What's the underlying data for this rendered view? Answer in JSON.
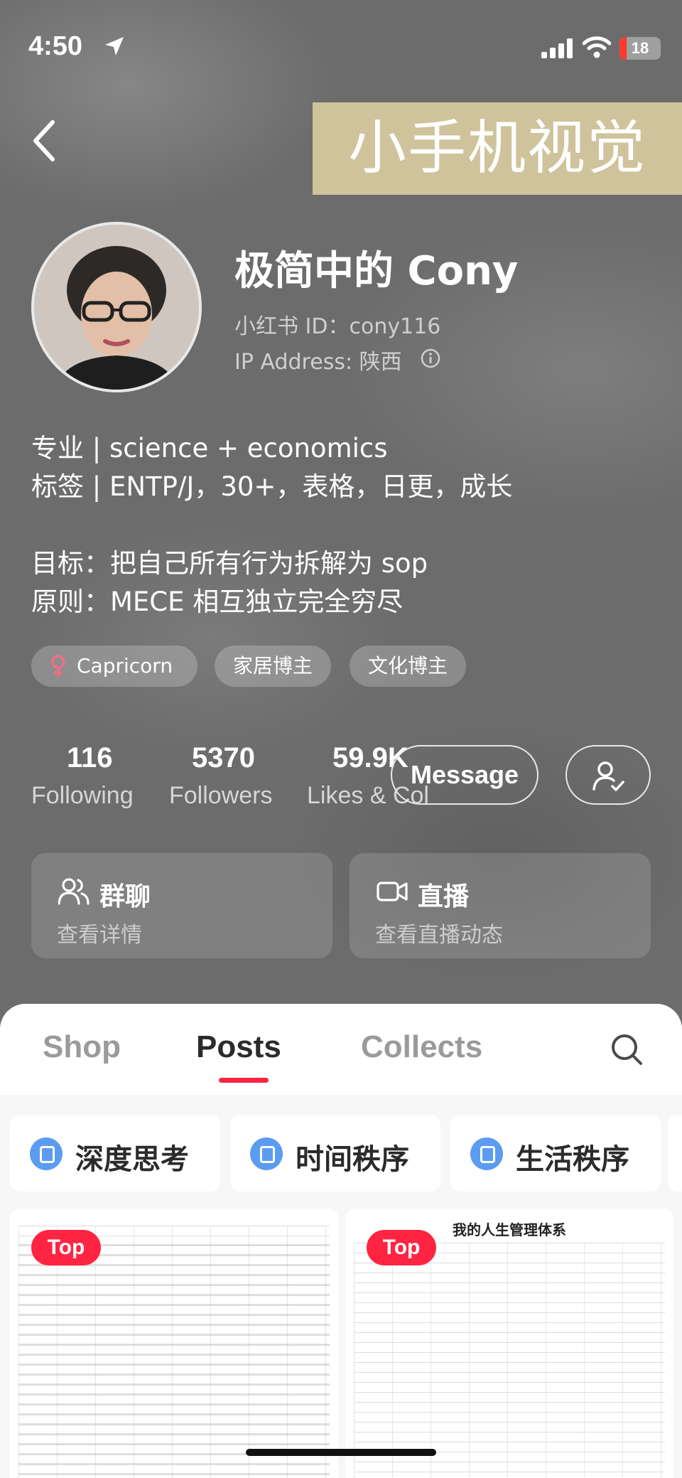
{
  "status": {
    "time": "4:50",
    "battery": "18",
    "battery_color": "#ff3b30"
  },
  "watermark": "小手机视觉",
  "profile": {
    "nickname": "极简中的 Cony",
    "red_id": "小红书 ID：cony116",
    "ip": "IP Address: 陕西",
    "bio": [
      "专业 | science + economics",
      "标签 | ENTP/J，30+，表格，日更，成长",
      "",
      "目标：把自己所有行为拆解为 sop",
      "原则：MECE 相互独立完全穷尽"
    ],
    "tags": [
      "Capricorn",
      "家居博主",
      "文化博主"
    ]
  },
  "stats": {
    "following_count": "116",
    "following_label": "Following",
    "followers_count": "5370",
    "followers_label": "Followers",
    "likes_count": "59.9K",
    "likes_label": "Likes & Col"
  },
  "actions": {
    "message_label": "Message"
  },
  "cards": {
    "group_title": "群聊",
    "group_sub": "查看详情",
    "live_title": "直播",
    "live_sub": "查看直播动态"
  },
  "tabs": [
    "Shop",
    "Posts",
    "Collects"
  ],
  "active_tab": "Posts",
  "collections": [
    "深度思考",
    "时间秩序",
    "生活秩序"
  ],
  "posts": [
    {
      "badge": "Top",
      "title": ""
    },
    {
      "badge": "Top",
      "title": "我的人生管理体系"
    }
  ],
  "colors": {
    "accent": "#ff2442",
    "collection_icon": "#5b9cf0",
    "watermark_bg": "#cfc39c"
  }
}
